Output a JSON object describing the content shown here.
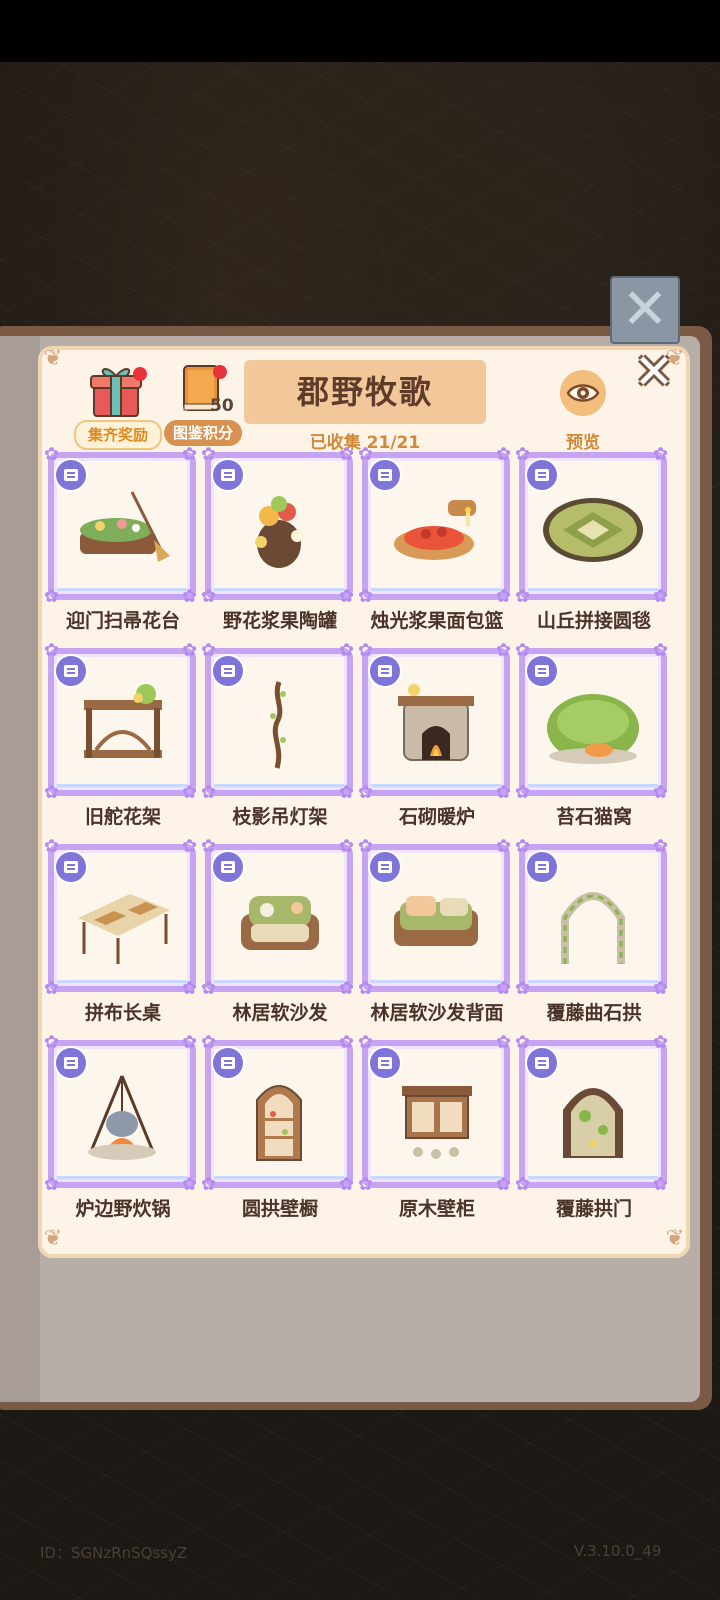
{
  "header": {
    "title": "郡野牧歌",
    "collected": "已收集 21/21",
    "reward_label": "集齐奖励",
    "points_label": "图鉴积分",
    "points_value": "50",
    "preview_label": "预览"
  },
  "items": [
    {
      "label": "迎门扫帚花台",
      "art": "broom-planter"
    },
    {
      "label": "野花浆果陶罐",
      "art": "berry-jar"
    },
    {
      "label": "烛光浆果面包篮",
      "art": "bread-basket"
    },
    {
      "label": "山丘拼接圆毯",
      "art": "round-rug"
    },
    {
      "label": "旧舵花架",
      "art": "flower-shelf"
    },
    {
      "label": "枝影吊灯架",
      "art": "branch-lamp"
    },
    {
      "label": "石砌暖炉",
      "art": "stone-fireplace"
    },
    {
      "label": "苔石猫窝",
      "art": "moss-cat-bed"
    },
    {
      "label": "拼布长桌",
      "art": "patchwork-table"
    },
    {
      "label": "林居软沙发",
      "art": "forest-sofa"
    },
    {
      "label": "林居软沙发背面",
      "art": "sofa-back"
    },
    {
      "label": "覆藤曲石拱",
      "art": "vine-arch"
    },
    {
      "label": "炉边野炊锅",
      "art": "campfire-pot"
    },
    {
      "label": "圆拱壁橱",
      "art": "arched-cabinet"
    },
    {
      "label": "原木壁柜",
      "art": "wood-wall-cabinet"
    },
    {
      "label": "覆藤拱门",
      "art": "vine-door"
    }
  ],
  "footer": {
    "id_text": "ID：SGNzRnSQssyZ",
    "version": "V.3.10.0_49"
  }
}
